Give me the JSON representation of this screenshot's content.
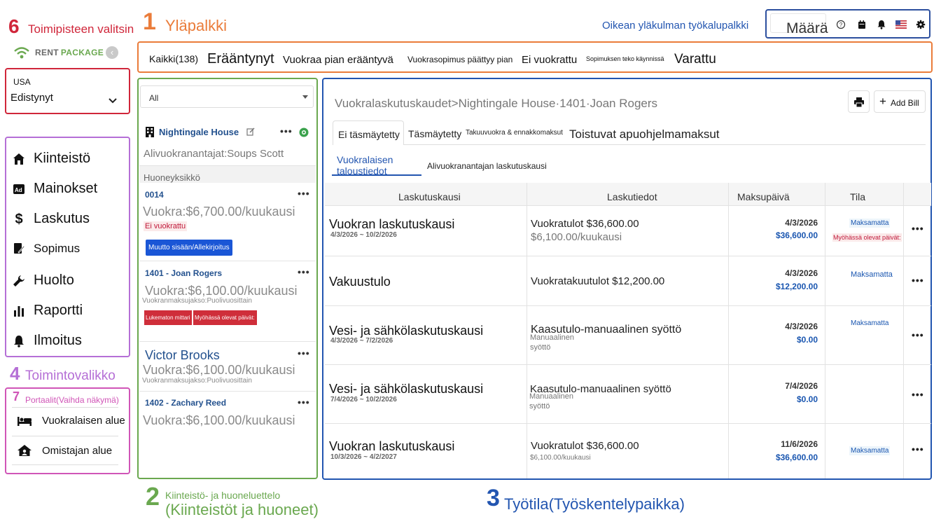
{
  "annotations": {
    "selector": {
      "num": "6",
      "label": "Toimipisteen valitsin"
    },
    "topbar": {
      "num": "1",
      "label": "Yläpalkki"
    },
    "toolbar": {
      "label": "Oikean yläkulman työkalupalkki"
    },
    "menu": {
      "num": "4",
      "label": "Toimintovalikko"
    },
    "portal": {
      "num": "7",
      "label": "Portaalit(Vaihda näkymä)"
    },
    "list": {
      "num": "2",
      "label_1": "Kiinteistö- ja huoneluettelo",
      "label_2": "(Kiinteistöt ja huoneet)"
    },
    "workspace": {
      "num": "3",
      "label": "Työtila(Työskentelypaikka)"
    }
  },
  "logo": {
    "part1": "RENT",
    "part2": "PACKAGE",
    "back_icon": "chevron-left-icon"
  },
  "location": {
    "country": "USA",
    "value": "Edistynyt"
  },
  "menu": [
    {
      "label": "Kiinteistö",
      "icon": "home-icon"
    },
    {
      "label": "Mainokset",
      "icon": "ad-icon"
    },
    {
      "label": "Laskutus",
      "icon": "dollar-icon"
    },
    {
      "label": "Sopimus",
      "icon": "contract-icon"
    },
    {
      "label": "Huolto",
      "icon": "wrench-icon"
    },
    {
      "label": "Raportti",
      "icon": "bar-chart-icon"
    },
    {
      "label": "Ilmoitus",
      "icon": "bell-icon"
    }
  ],
  "portals": [
    {
      "label": "Vuokralaisen alue",
      "icon": "bed-icon"
    },
    {
      "label": "Omistajan alue",
      "icon": "house-user-icon"
    }
  ],
  "filters": [
    "Kaikki(138)",
    "Erääntynyt",
    "Vuokraa pian erääntyvä",
    "Vuokrasopimus päättyy pian",
    "Ei vuokrattu",
    "Sopimuksen teko käynnissä",
    "Varattu"
  ],
  "toolbar": {
    "quantity": "Määrä",
    "flag": "us-flag-icon"
  },
  "property_list": {
    "filter_value": "All",
    "property": {
      "name": "Nightingale House",
      "sublandlord": "Alivuokranantajat:Soups Scott"
    },
    "section_label": "Huoneyksikkö",
    "rooms": [
      {
        "code": "0014",
        "rent": "Vuokra:$6,700.00/kuukausi",
        "tag": "Ei vuokrattu",
        "button": "Muutto sisään/Allekirjoitus"
      },
      {
        "code": "1401 - Joan Rogers",
        "rent": "Vuokra:$6,100.00/kuukausi",
        "cycle": "Vuokranmaksujakso:Puolivuosittain",
        "badge_1": "Lukematon mittari",
        "badge_2": "Myöhässä olevat päivät:"
      },
      {
        "code": "Victor Brooks",
        "rent": "Vuokra:$6,100.00/kuukausi",
        "cycle": "Vuokranmaksujakso:Puolivuosittain"
      },
      {
        "code": "1402 - Zachary Reed",
        "rent": "Vuokra:$6,100.00/kuukausi"
      }
    ]
  },
  "workspace": {
    "breadcrumb": "Vuokralaskutuskaudet>Nightingale House·1401·Joan Rogers",
    "add_bill": "Add Bill",
    "tabs": [
      "Ei täsmäytetty",
      "Täsmäytetty",
      "Takuuvuokra & ennakkomaksut",
      "Toistuvat apuohjelmamaksut"
    ],
    "subtabs": [
      "Vuokralaisen taloustiedot",
      "Alivuokranantajan laskutuskausi"
    ],
    "columns": [
      "Laskutuskausi",
      "Laskutiedot",
      "Maksupäivä",
      "Tila"
    ],
    "rows": [
      {
        "period": "Vuokran laskutuskausi",
        "range": "4/3/2026 ~ 10/2/2026",
        "info": "Vuokratulot $36,600.00",
        "info_sub": "$6,100.00/kuukausi",
        "date": "4/3/2026",
        "amount": "$36,600.00",
        "status": "Maksamatta",
        "status_2": "Myöhässä olevat päivät:"
      },
      {
        "period": "Vakuustulo",
        "range": "",
        "info": "Vuokratakuutulot $12,200.00",
        "info_sub": "",
        "date": "4/3/2026",
        "amount": "$12,200.00",
        "status": "Maksamatta"
      },
      {
        "period": "Vesi- ja sähkölaskutuskausi",
        "range": "4/3/2026 ~ 7/2/2026",
        "info": "Kaasutulo-manuaalinen syöttö",
        "info_sub": "Manuaalinen syöttö",
        "date": "4/3/2026",
        "amount": "$0.00",
        "status": "Maksamatta"
      },
      {
        "period": "Vesi- ja sähkölaskutuskausi",
        "range": "7/4/2026 ~ 10/2/2026",
        "info": "Kaasutulo-manuaalinen syöttö",
        "info_sub": "Manuaalinen syöttö",
        "date": "7/4/2026",
        "amount": "$0.00",
        "status": ""
      },
      {
        "period": "Vuokran laskutuskausi",
        "range": "10/3/2026 ~ 4/2/2027",
        "info": "Vuokratulot $36,600.00",
        "info_sub": "$6,100.00/kuukausi",
        "date": "11/6/2026",
        "amount": "$36,600.00",
        "status": "Maksamatta"
      }
    ]
  }
}
